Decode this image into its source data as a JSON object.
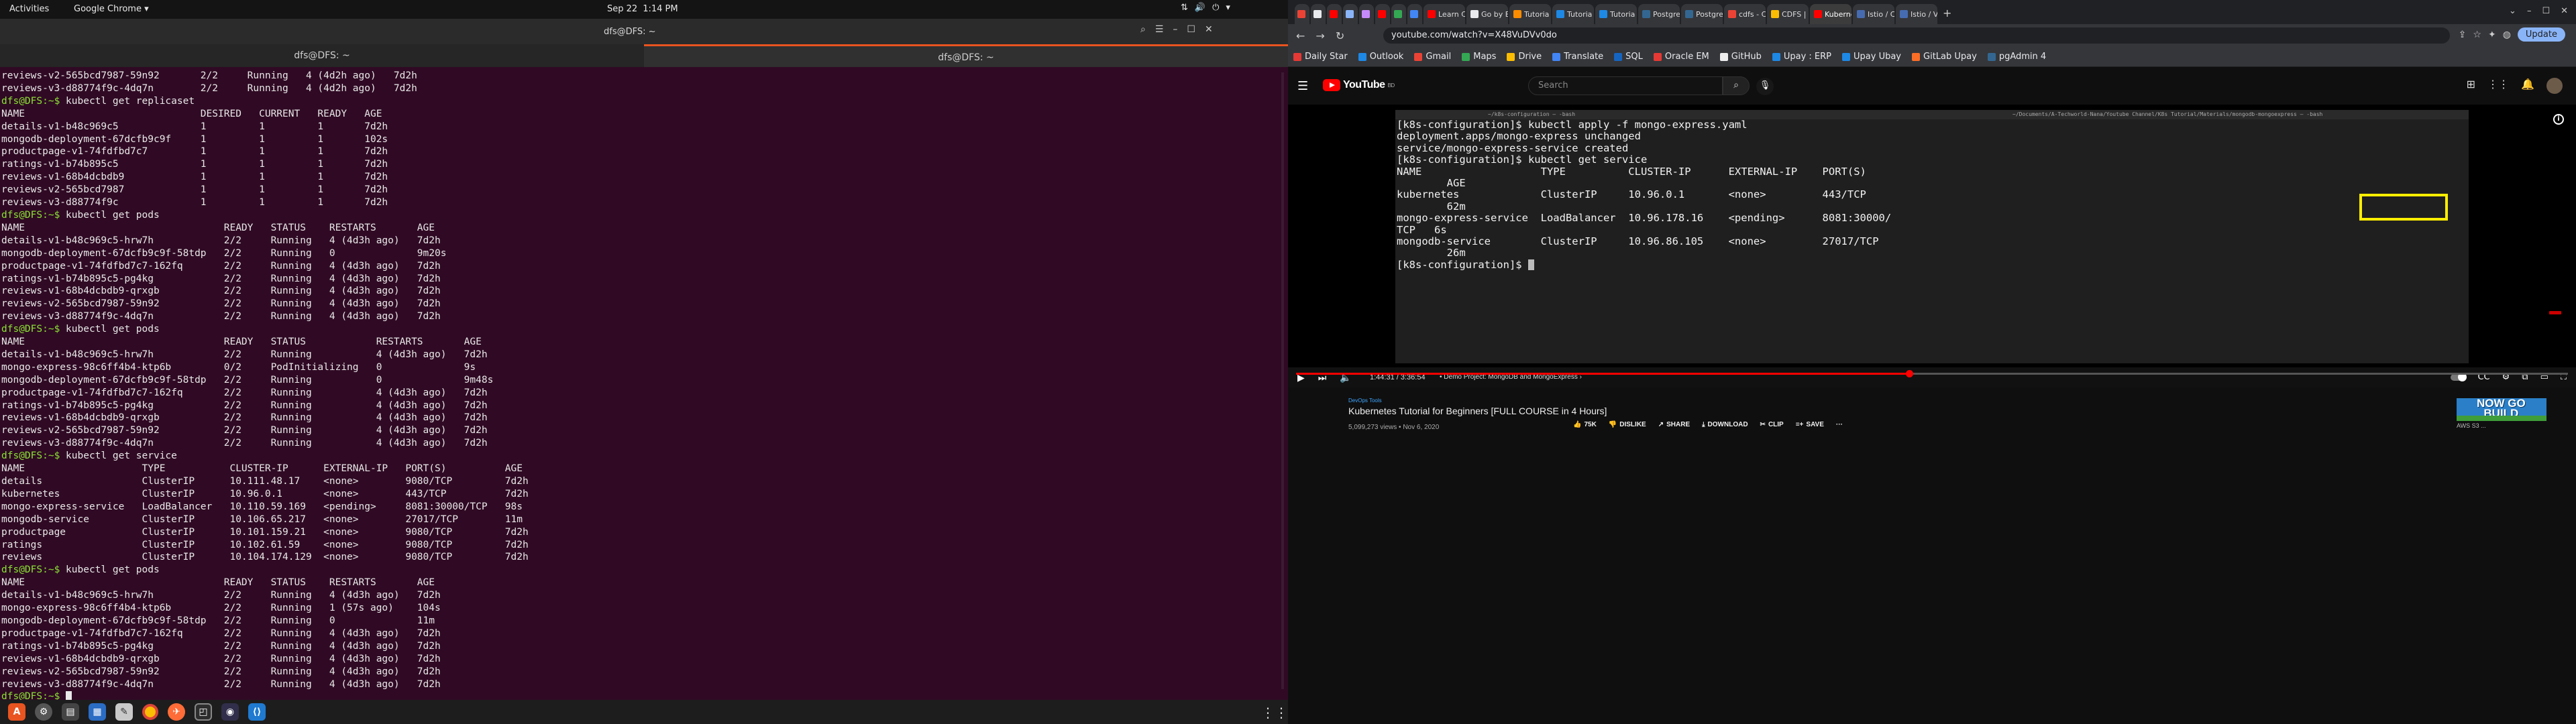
{
  "topbar": {
    "activities": "Activities",
    "app": "Google Chrome ▾",
    "date": "Sep 22",
    "time": "1:14 PM"
  },
  "terminal": {
    "title": "dfs@DFS: ~",
    "tabs": [
      "dfs@DFS: ~",
      "dfs@DFS: ~"
    ],
    "lines": [
      "reviews-v2-565bcd7987-59n92       2/2     Running   4 (4d2h ago)   7d2h",
      "reviews-v3-d88774f9c-4dq7n        2/2     Running   4 (4d2h ago)   7d2h",
      "dfs@DFS:~$ kubectl get replicaset",
      "NAME                              DESIRED   CURRENT   READY   AGE",
      "details-v1-b48c969c5              1         1         1       7d2h",
      "mongodb-deployment-67dcfb9c9f     1         1         1       102s",
      "productpage-v1-74fdfbd7c7         1         1         1       7d2h",
      "ratings-v1-b74b895c5              1         1         1       7d2h",
      "reviews-v1-68b4dcbdb9             1         1         1       7d2h",
      "reviews-v2-565bcd7987             1         1         1       7d2h",
      "reviews-v3-d88774f9c              1         1         1       7d2h",
      "dfs@DFS:~$ kubectl get pods",
      "NAME                                  READY   STATUS    RESTARTS       AGE",
      "details-v1-b48c969c5-hrw7h            2/2     Running   4 (4d3h ago)   7d2h",
      "mongodb-deployment-67dcfb9c9f-58tdp   2/2     Running   0              9m20s",
      "productpage-v1-74fdfbd7c7-162fq       2/2     Running   4 (4d3h ago)   7d2h",
      "ratings-v1-b74b895c5-pg4kg            2/2     Running   4 (4d3h ago)   7d2h",
      "reviews-v1-68b4dcbdb9-qrxgb           2/2     Running   4 (4d3h ago)   7d2h",
      "reviews-v2-565bcd7987-59n92           2/2     Running   4 (4d3h ago)   7d2h",
      "reviews-v3-d88774f9c-4dq7n            2/2     Running   4 (4d3h ago)   7d2h",
      "dfs@DFS:~$ kubectl get pods",
      "NAME                                  READY   STATUS            RESTARTS       AGE",
      "details-v1-b48c969c5-hrw7h            2/2     Running           4 (4d3h ago)   7d2h",
      "mongo-express-98c6ff4b4-ktp6b         0/2     PodInitializing   0              9s",
      "mongodb-deployment-67dcfb9c9f-58tdp   2/2     Running           0              9m48s",
      "productpage-v1-74fdfbd7c7-162fq       2/2     Running           4 (4d3h ago)   7d2h",
      "ratings-v1-b74b895c5-pg4kg            2/2     Running           4 (4d3h ago)   7d2h",
      "reviews-v1-68b4dcbdb9-qrxgb           2/2     Running           4 (4d3h ago)   7d2h",
      "reviews-v2-565bcd7987-59n92           2/2     Running           4 (4d3h ago)   7d2h",
      "reviews-v3-d88774f9c-4dq7n            2/2     Running           4 (4d3h ago)   7d2h",
      "dfs@DFS:~$ kubectl get service",
      "NAME                    TYPE           CLUSTER-IP      EXTERNAL-IP   PORT(S)          AGE",
      "details                 ClusterIP      10.111.48.17    <none>        9080/TCP         7d2h",
      "kubernetes              ClusterIP      10.96.0.1       <none>        443/TCP          7d2h",
      "mongo-express-service   LoadBalancer   10.110.59.169   <pending>     8081:30000/TCP   98s",
      "mongodb-service         ClusterIP      10.106.65.217   <none>        27017/TCP        11m",
      "productpage             ClusterIP      10.101.159.21   <none>        9080/TCP         7d2h",
      "ratings                 ClusterIP      10.102.61.59    <none>        9080/TCP         7d2h",
      "reviews                 ClusterIP      10.104.174.129  <none>        9080/TCP         7d2h",
      "dfs@DFS:~$ kubectl get pods",
      "NAME                                  READY   STATUS    RESTARTS       AGE",
      "details-v1-b48c969c5-hrw7h            2/2     Running   4 (4d3h ago)   7d2h",
      "mongo-express-98c6ff4b4-ktp6b         2/2     Running   1 (57s ago)    104s",
      "mongodb-deployment-67dcfb9c9f-58tdp   2/2     Running   0              11m",
      "productpage-v1-74fdfbd7c7-162fq       2/2     Running   4 (4d3h ago)   7d2h",
      "ratings-v1-b74b895c5-pg4kg            2/2     Running   4 (4d3h ago)   7d2h",
      "reviews-v1-68b4dcbdb9-qrxgb           2/2     Running   4 (4d3h ago)   7d2h",
      "reviews-v2-565bcd7987-59n92           2/2     Running   4 (4d3h ago)   7d2h",
      "reviews-v3-d88774f9c-4dq7n            2/2     Running   4 (4d3h ago)   7d2h"
    ],
    "prompt": "dfs@DFS:~$ "
  },
  "dock": {
    "icons": [
      "ubuntu-software-icon",
      "settings-icon",
      "files-icon",
      "documents-icon",
      "text-editor-icon",
      "chrome-icon",
      "postman-icon",
      "screenshot-icon",
      "obs-icon",
      "vscode-icon"
    ]
  },
  "chrome": {
    "tabs": [
      "",
      "",
      "",
      "",
      "",
      "",
      "",
      "",
      "Learn C",
      "Go by E",
      "Tutoria",
      "Tutoria",
      "Tutoria",
      "Postgre",
      "Postgre",
      "cdfs - C",
      "CDFS | C",
      "Kuberne",
      "Istio / C",
      "Istio / V"
    ],
    "active_tab_index": 17,
    "url": "youtube.com/watch?v=X48VuDVv0do",
    "update_label": "Update",
    "bookmarks": [
      "Daily Star",
      "Outlook",
      "Gmail",
      "Maps",
      "Drive",
      "Translate",
      "SQL",
      "Oracle EM",
      "GitHub",
      "Upay : ERP",
      "Upay Ubay",
      "GitLab Upay",
      "pgAdmin 4"
    ],
    "bookmark_colors": [
      "#e53935",
      "#1e88e5",
      "#ea4335",
      "#34a853",
      "#fbbc04",
      "#4285f4",
      "#1565c0",
      "#e53935",
      "#eeeeee",
      "#1e88e5",
      "#1e88e5",
      "#fc6d26",
      "#336791"
    ]
  },
  "youtube": {
    "logo": "YouTube",
    "logo_sup": "BD",
    "search_placeholder": "Search",
    "video_terminal": {
      "tabs": [
        "~/k8s-configuration — -bash",
        "~/Documents/A-Techworld-Nana/Youtube Channel/K8s Tutorial/Materials/mongodb-mongoexpress — -bash"
      ],
      "lines": [
        "[k8s-configuration]$ kubectl apply -f mongo-express.yaml",
        "deployment.apps/mongo-express unchanged",
        "service/mongo-express-service created",
        "[k8s-configuration]$ kubectl get service",
        "NAME                   TYPE          CLUSTER-IP      EXTERNAL-IP    PORT(S)",
        "        AGE",
        "kubernetes             ClusterIP     10.96.0.1       <none>         443/TCP",
        "        62m",
        "mongo-express-service  LoadBalancer  10.96.178.16    <pending>      8081:30000/",
        "TCP   6s",
        "mongodb-service        ClusterIP     10.96.86.105    <none>         27017/TCP",
        "        26m"
      ],
      "prompt": "[k8s-configuration]$ "
    },
    "player": {
      "time": "1:44:31 / 3:36:54",
      "chapter": "• Demo Project: MongoDB and MongoExpress ›",
      "progress": 0.482
    },
    "channel": "DevOps Tools",
    "title": "Kubernetes Tutorial for Beginners [FULL COURSE in 4 Hours]",
    "meta": "5,099,273 views • Nov 6, 2020",
    "actions": {
      "like": "75K",
      "dislike": "DISLIKE",
      "share": "SHARE",
      "download": "DOWNLOAD",
      "clip": "CLIP",
      "save": "SAVE",
      "more": "···"
    },
    "ad": {
      "text1": "NOW GO",
      "text2": "BUILD",
      "label": "AWS S3 ..."
    }
  }
}
